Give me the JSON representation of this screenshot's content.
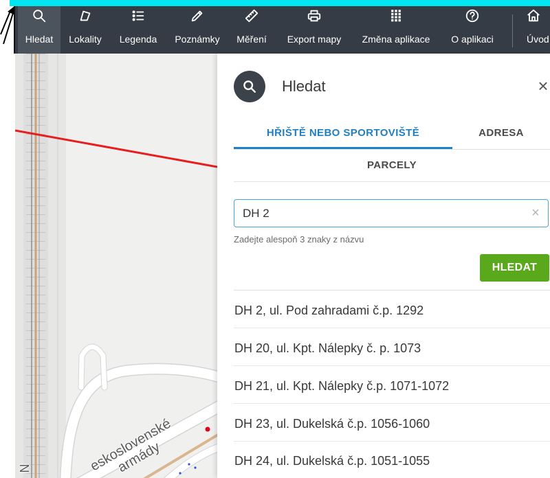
{
  "colors": {
    "banner": "#00e5f0",
    "toolbar_bg": "#353c45",
    "toolbar_active": "#4b535d",
    "accent": "#1f7fc4",
    "button": "#5aa81c",
    "route": "#e61e1e",
    "input_border": "#4aa3df"
  },
  "toolbar": {
    "items": [
      {
        "label": "Hledat",
        "icon": "search-icon",
        "active": true
      },
      {
        "label": "Lokality",
        "icon": "polygon-icon",
        "active": false
      },
      {
        "label": "Legenda",
        "icon": "list-icon",
        "active": false
      },
      {
        "label": "Poznámky",
        "icon": "pencil-icon",
        "active": false
      },
      {
        "label": "Měření",
        "icon": "ruler-icon",
        "active": false
      },
      {
        "label": "Export mapy",
        "icon": "printer-icon",
        "active": false
      },
      {
        "label": "Změna aplikace",
        "icon": "apps-grid-icon",
        "active": false
      },
      {
        "label": "O aplikaci",
        "icon": "help-icon",
        "active": false
      },
      {
        "label": "Úvod",
        "icon": "home-icon",
        "active": false
      }
    ]
  },
  "map": {
    "street_label_line1": "eskoslovenské",
    "street_label_line2": "armády",
    "edge_label": "N"
  },
  "panel": {
    "icon": "search-icon",
    "title": "Hledat",
    "close_symbol": "×",
    "tabs": [
      {
        "label": "HŘIŠTĚ NEBO SPORTOVIŠTĚ",
        "active": true
      },
      {
        "label": "ADRESA",
        "active": false
      },
      {
        "label": "PARCELY",
        "active": false
      }
    ],
    "search": {
      "value": "DH 2",
      "clear_symbol": "×",
      "hint": "Zadejte alespoň 3 znaky z názvu",
      "button_label": "HLEDAT"
    },
    "results": [
      "DH 2, ul. Pod zahradami č.p. 1292",
      "DH 20, ul. Kpt. Nálepky č. p. 1073",
      "DH 21, ul. Kpt. Nálepky č.p. 1071-1072",
      "DH 23, ul. Dukelská č.p. 1056-1060",
      "DH 24, ul. Dukelská č.p. 1051-1055"
    ]
  }
}
